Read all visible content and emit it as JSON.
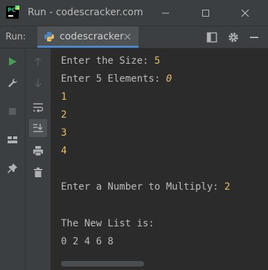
{
  "window": {
    "title": "Run - codescracker.com",
    "logo_text": "PC"
  },
  "run_panel": {
    "label": "Run:",
    "tab_label": "codescracker"
  },
  "colors": {
    "input_text": "#e8bf6a",
    "output_text": "#bbbbbb",
    "run_green": "#499c54",
    "tab_accent": "#4a88c7"
  },
  "console": {
    "lines": [
      {
        "prompt": "Enter the Size: ",
        "input": "5"
      },
      {
        "prompt": "Enter 5 Elements: ",
        "input": "0"
      },
      {
        "prompt": "",
        "input": "1"
      },
      {
        "prompt": "",
        "input": "2"
      },
      {
        "prompt": "",
        "input": "3"
      },
      {
        "prompt": "",
        "input": "4"
      },
      {
        "prompt": "",
        "input": ""
      },
      {
        "prompt": "Enter a Number to Multiply: ",
        "input": "2"
      },
      {
        "prompt": "",
        "input": ""
      },
      {
        "prompt": "The New List is:",
        "input": ""
      },
      {
        "prompt": "0 2 4 6 8",
        "input": ""
      }
    ]
  },
  "icons": {
    "toolbar_left": [
      "run-icon",
      "wrench-icon",
      "stop-icon",
      "layout-icon",
      "pin-icon"
    ],
    "toolbar_right": [
      "arrow-up-icon",
      "arrow-down-icon",
      "soft-wrap-icon",
      "scroll-to-end-icon",
      "print-icon",
      "trash-icon"
    ],
    "header": [
      "layout-icon",
      "gear-icon",
      "minimize-icon"
    ]
  }
}
